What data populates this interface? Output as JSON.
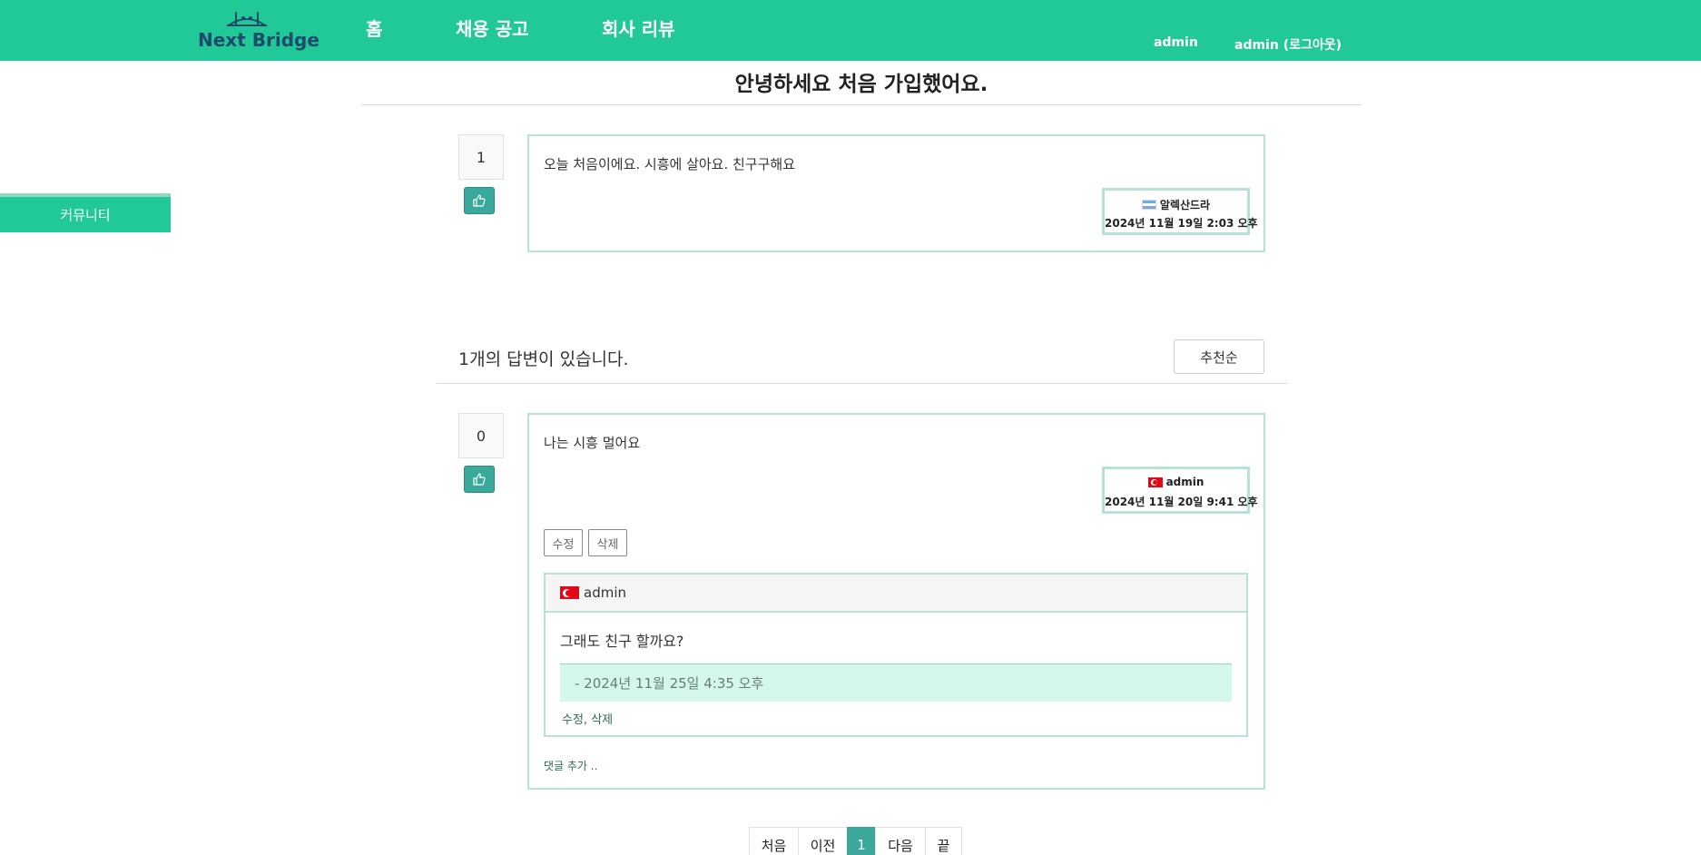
{
  "navbar": {
    "logo_text": "Next Bridge",
    "links": [
      "홈",
      "채용 공고",
      "회사 리뷰"
    ],
    "user": "admin",
    "logout": "admin (로그아웃)"
  },
  "sidebar": {
    "community": "커뮤니티"
  },
  "question": {
    "title": "안녕하세요 처음 가입했어요.",
    "votes": "1",
    "body": "오늘 처음이에요. 시흥에 살아요. 친구구해요",
    "author": "알렉산드라",
    "author_flag": "argentina-flag-icon",
    "date": "2024년 11월 19일 2:03 오후"
  },
  "answers_header": {
    "count_text": "1개의 답변이 있습니다.",
    "sort_label": "추천순"
  },
  "answer": {
    "votes": "0",
    "body": "나는 시흥 멀어요",
    "author": "admin",
    "author_flag": "turkey-flag-icon",
    "date": "2024년 11월 20일 9:41 오후",
    "edit_label": "수정",
    "delete_label": "삭제"
  },
  "comment": {
    "author": "admin",
    "author_flag": "turkey-flag-icon",
    "body": "그래도 친구 할까요?",
    "date": "- 2024년 11월 25일 4:35 오후",
    "edit_label": "수정",
    "separator": ",",
    "delete_label": "삭제"
  },
  "add_comment": "댓글 추가 ..",
  "pagination": {
    "first": "처음",
    "prev": "이전",
    "current": "1",
    "next": "다음",
    "last": "끝"
  },
  "colors": {
    "brand": "#20c997",
    "accent": "#3aa89a",
    "card_border": "#b8e2d8",
    "comment_date_bg": "#d4f7ec"
  }
}
